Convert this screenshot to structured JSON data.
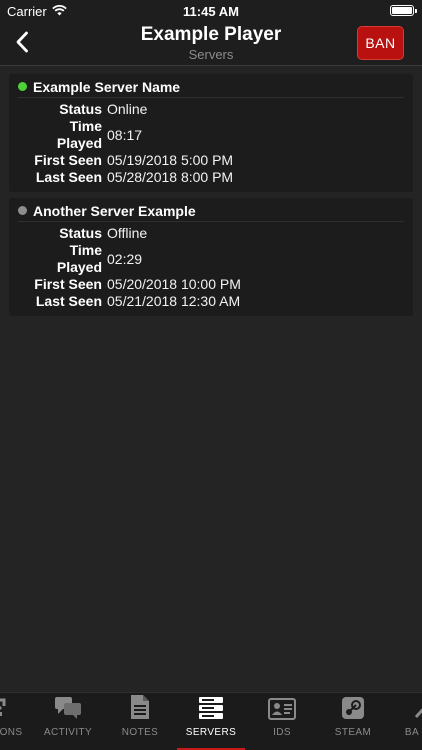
{
  "status_bar": {
    "carrier": "Carrier",
    "time": "11:45 AM"
  },
  "nav": {
    "title": "Example Player",
    "subtitle": "Servers",
    "ban_label": "BAN"
  },
  "labels": {
    "status": "Status",
    "time_played_1": "Time",
    "time_played_2": "Played",
    "first_seen": "First Seen",
    "last_seen": "Last Seen"
  },
  "servers": [
    {
      "name": "Example Server Name",
      "status": "Online",
      "time_played": "08:17",
      "first_seen": "05/19/2018 5:00 PM",
      "last_seen": "05/28/2018 8:00 PM",
      "dot_color": "#4cd137"
    },
    {
      "name": "Another Server Example",
      "status": "Offline",
      "time_played": "02:29",
      "first_seen": "05/20/2018 10:00 PM",
      "last_seen": "05/21/2018 12:30 AM",
      "dot_color": "#8e8e8e"
    }
  ],
  "tabs": [
    {
      "label": "ONS",
      "icon": "actions-icon"
    },
    {
      "label": "ACTIVITY",
      "icon": "chat-bubbles-icon"
    },
    {
      "label": "NOTES",
      "icon": "document-icon"
    },
    {
      "label": "SERVERS",
      "icon": "server-rack-icon",
      "active": true
    },
    {
      "label": "IDS",
      "icon": "id-card-icon"
    },
    {
      "label": "STEAM",
      "icon": "steam-icon"
    },
    {
      "label": "BA",
      "icon": "ban-hammer-icon"
    }
  ],
  "colors": {
    "accent": "#c5191a",
    "ban_button": "#b8110f",
    "background": "#242424"
  }
}
